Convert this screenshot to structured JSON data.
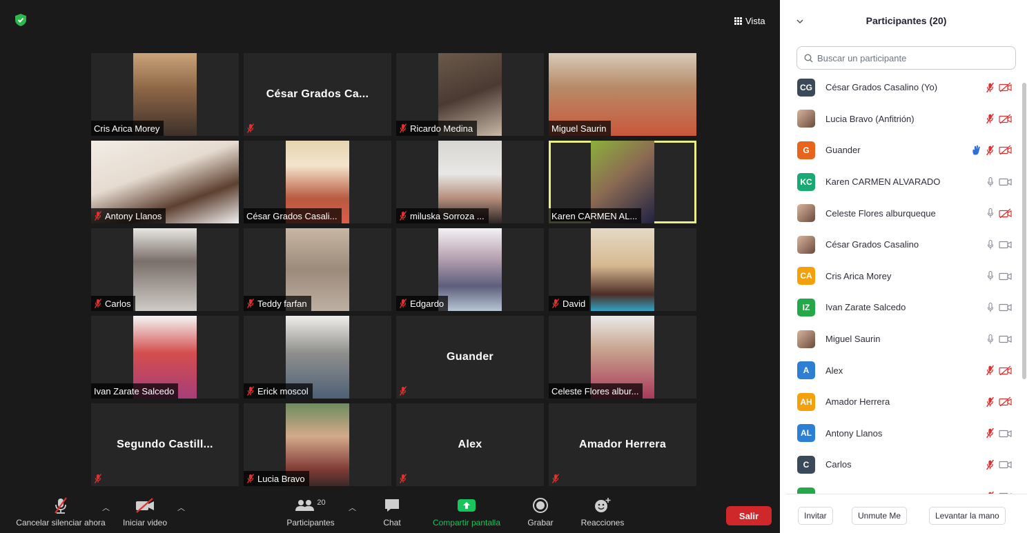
{
  "meeting": {
    "view_label": "Vista",
    "tiles": [
      {
        "name": "Cris Arica Morey",
        "video": "v1",
        "muted": false,
        "wide": false
      },
      {
        "name": "",
        "center": "César Grados Ca...",
        "muted": true
      },
      {
        "name": "Ricardo Medina",
        "video": "v2",
        "muted": true,
        "wide": false
      },
      {
        "name": "Miguel Saurin",
        "video": "v3",
        "muted": false,
        "wide": true
      },
      {
        "name": "Antony Llanos",
        "video": "v4",
        "muted": true,
        "wide": true
      },
      {
        "name": "César Grados Casali...",
        "video": "v5",
        "muted": false,
        "wide": false
      },
      {
        "name": "miluska Sorroza ...",
        "video": "v6",
        "muted": true,
        "wide": false
      },
      {
        "name": "Karen CARMEN  AL...",
        "video": "v7",
        "muted": false,
        "wide": false,
        "active": true
      },
      {
        "name": "Carlos",
        "video": "v8",
        "muted": true,
        "wide": false
      },
      {
        "name": "Teddy farfan",
        "video": "v9",
        "muted": true,
        "wide": false
      },
      {
        "name": "Edgardo",
        "video": "v10",
        "muted": true,
        "wide": false
      },
      {
        "name": "David",
        "video": "v11",
        "muted": true,
        "wide": false
      },
      {
        "name": "Ivan Zarate Salcedo",
        "video": "v12",
        "muted": false,
        "wide": false
      },
      {
        "name": "Erick moscol",
        "video": "v13",
        "muted": true,
        "wide": false
      },
      {
        "name": "",
        "center": "Guander",
        "muted": true
      },
      {
        "name": "Celeste Flores albur...",
        "video": "v14",
        "muted": false,
        "wide": false
      },
      {
        "name": "",
        "center": "Segundo  Castill...",
        "muted": true
      },
      {
        "name": "Lucia Bravo",
        "video": "v15",
        "muted": true,
        "wide": false
      },
      {
        "name": "",
        "center": "Alex",
        "muted": true
      },
      {
        "name": "",
        "center": "Amador Herrera",
        "muted": true
      }
    ]
  },
  "toolbar": {
    "unmute_label": "Cancelar silenciar ahora",
    "video_label": "Iniciar video",
    "participants_label": "Participantes",
    "participants_count": "20",
    "chat_label": "Chat",
    "share_label": "Compartir pantalla",
    "record_label": "Grabar",
    "reactions_label": "Reacciones",
    "leave_label": "Salir"
  },
  "panel": {
    "title": "Participantes (20)",
    "search_placeholder": "Buscar un participante",
    "participants": [
      {
        "initials": "CG",
        "color": "#3b4a5a",
        "name": "César Grados Casalino (Yo)",
        "mic": "off",
        "cam": "off"
      },
      {
        "initials": "",
        "photo": true,
        "name": "Lucia Bravo (Anfitrión)",
        "mic": "off",
        "cam": "off"
      },
      {
        "initials": "G",
        "color": "#e8631c",
        "name": "Guander",
        "mic": "off",
        "cam": "off",
        "hand": true
      },
      {
        "initials": "KC",
        "color": "#19a974",
        "name": "Karen CARMEN  ALVARADO",
        "mic": "on",
        "cam": "on"
      },
      {
        "initials": "",
        "photo": true,
        "name": "Celeste Flores alburqueque",
        "mic": "on",
        "cam": "off"
      },
      {
        "initials": "",
        "photo": true,
        "name": "César Grados Casalino",
        "mic": "on",
        "cam": "on"
      },
      {
        "initials": "CA",
        "color": "#f2a10c",
        "name": "Cris Arica Morey",
        "mic": "on",
        "cam": "on"
      },
      {
        "initials": "IZ",
        "color": "#25a84a",
        "name": "Ivan Zarate Salcedo",
        "mic": "on",
        "cam": "on"
      },
      {
        "initials": "",
        "photo": true,
        "name": "Miguel Saurin",
        "mic": "on",
        "cam": "on"
      },
      {
        "initials": "A",
        "color": "#2d7fd3",
        "name": "Alex",
        "mic": "off",
        "cam": "off"
      },
      {
        "initials": "AH",
        "color": "#f2a10c",
        "name": "Amador Herrera",
        "mic": "off",
        "cam": "off"
      },
      {
        "initials": "AL",
        "color": "#2d7fd3",
        "name": "Antony Llanos",
        "mic": "off",
        "cam": "on"
      },
      {
        "initials": "C",
        "color": "#3b4a5a",
        "name": "Carlos",
        "mic": "off",
        "cam": "on"
      },
      {
        "initials": "",
        "color": "#25a84a",
        "name": "",
        "mic": "off",
        "cam": "on"
      }
    ],
    "invite_label": "Invitar",
    "unmute_me_label": "Unmute Me",
    "raise_hand_label": "Levantar la mano"
  },
  "colors": {
    "meeting_bg": "#1a1a1a",
    "tile_bg": "#262626",
    "muted_red": "#e0312f",
    "active_border": "#e9ee86",
    "leave_red": "#d0272a",
    "share_green": "#18c45c"
  }
}
